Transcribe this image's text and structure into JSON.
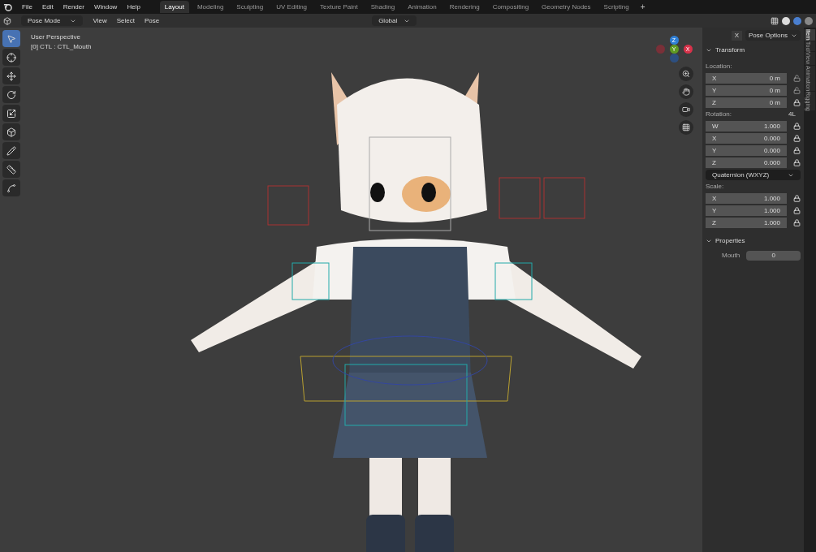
{
  "menu": [
    "File",
    "Edit",
    "Render",
    "Window",
    "Help"
  ],
  "workspaces": [
    {
      "label": "Layout",
      "selected": true
    },
    {
      "label": "Modeling",
      "selected": false
    },
    {
      "label": "Sculpting",
      "selected": false
    },
    {
      "label": "UV Editing",
      "selected": false
    },
    {
      "label": "Texture Paint",
      "selected": false
    },
    {
      "label": "Shading",
      "selected": false
    },
    {
      "label": "Animation",
      "selected": false
    },
    {
      "label": "Rendering",
      "selected": false
    },
    {
      "label": "Compositing",
      "selected": false
    },
    {
      "label": "Geometry Nodes",
      "selected": false
    },
    {
      "label": "Scripting",
      "selected": false
    }
  ],
  "add_workspace": "+",
  "header": {
    "mode": "Pose Mode",
    "menus": [
      "View",
      "Select",
      "Pose"
    ],
    "orientation": "Global",
    "pose_options": "Pose Options",
    "x_mirror": "X"
  },
  "viewport": {
    "title": "User Perspective",
    "subtitle": "[0] CTL : CTL_Mouth"
  },
  "gizmo": {
    "z": "Z",
    "y": "Y",
    "x": "X"
  },
  "tools": [
    {
      "kind": "select",
      "selected": true
    },
    {
      "kind": "cursor",
      "selected": false
    },
    {
      "kind": "move",
      "selected": false
    },
    {
      "kind": "rotate",
      "selected": false
    },
    {
      "kind": "scale",
      "selected": false
    },
    {
      "kind": "transform",
      "selected": false
    },
    {
      "kind": "annotate",
      "selected": false
    },
    {
      "kind": "measure",
      "selected": false
    },
    {
      "kind": "curve",
      "selected": false
    }
  ],
  "transform": {
    "title": "Transform",
    "location_label": "Location:",
    "location": [
      {
        "axis": "X",
        "value": "0 m",
        "locked": false
      },
      {
        "axis": "Y",
        "value": "0 m",
        "locked": false
      },
      {
        "axis": "Z",
        "value": "0 m",
        "locked": true
      }
    ],
    "rotation_label": "Rotation:",
    "rotation_lock_mode": "4L",
    "rotation": [
      {
        "axis": "W",
        "value": "1.000",
        "locked": true
      },
      {
        "axis": "X",
        "value": "0.000",
        "locked": true
      },
      {
        "axis": "Y",
        "value": "0.000",
        "locked": true
      },
      {
        "axis": "Z",
        "value": "0.000",
        "locked": true
      }
    ],
    "rotation_mode": "Quaternion (WXYZ)",
    "scale_label": "Scale:",
    "scale": [
      {
        "axis": "X",
        "value": "1.000",
        "locked": true
      },
      {
        "axis": "Y",
        "value": "1.000",
        "locked": true
      },
      {
        "axis": "Z",
        "value": "1.000",
        "locked": true
      }
    ]
  },
  "properties": {
    "title": "Properties",
    "fields": [
      {
        "label": "Mouth",
        "value": "0"
      }
    ]
  },
  "side_tabs": [
    {
      "label": "Item",
      "selected": true
    },
    {
      "label": "Tool",
      "selected": false
    },
    {
      "label": "View",
      "selected": false
    },
    {
      "label": "Animation",
      "selected": false
    },
    {
      "label": "Rigging",
      "selected": false
    }
  ]
}
